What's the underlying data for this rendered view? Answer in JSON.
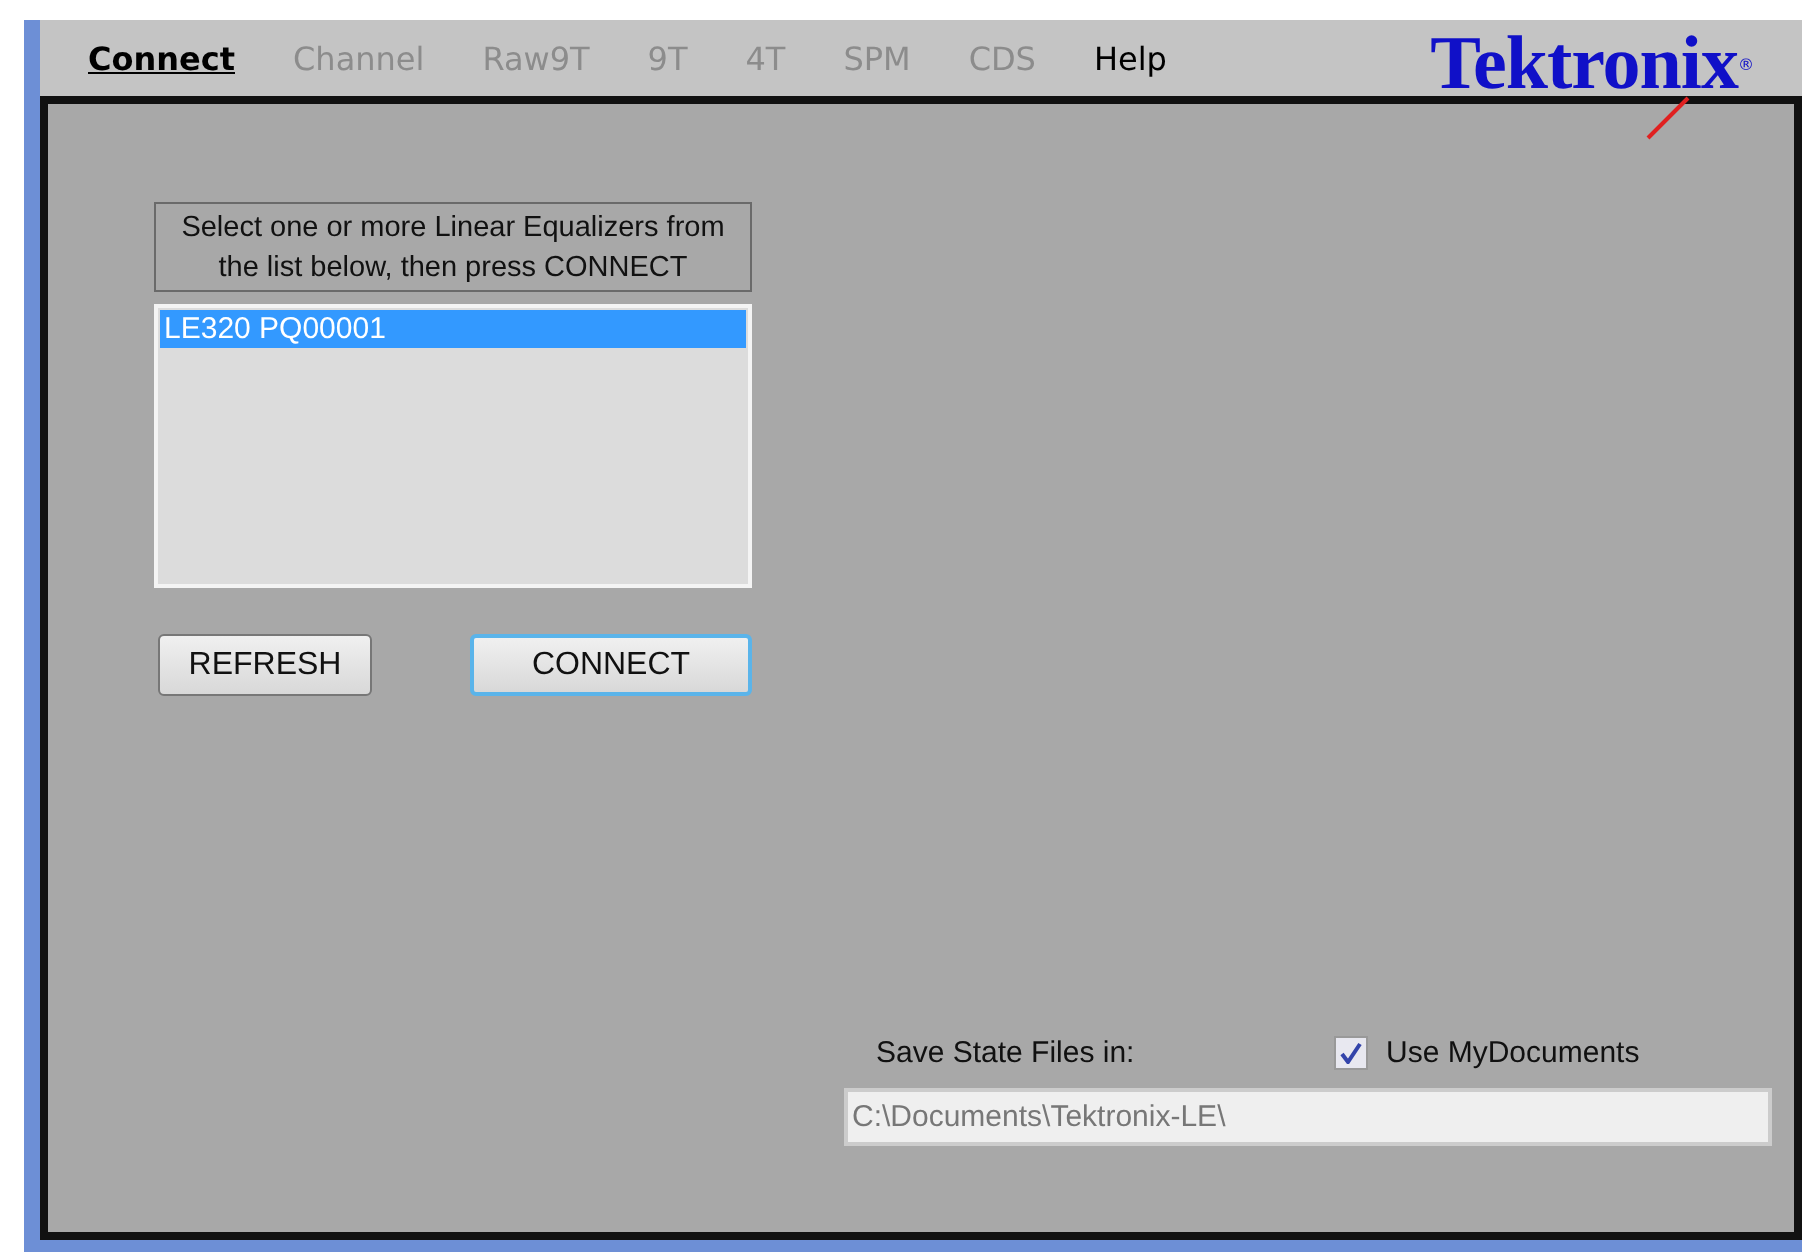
{
  "menu": [
    {
      "label": "Connect",
      "selected": true,
      "disabled": false
    },
    {
      "label": "Channel",
      "selected": false,
      "disabled": true
    },
    {
      "label": "Raw9T",
      "selected": false,
      "disabled": true
    },
    {
      "label": "9T",
      "selected": false,
      "disabled": true
    },
    {
      "label": "4T",
      "selected": false,
      "disabled": true
    },
    {
      "label": "SPM",
      "selected": false,
      "disabled": true
    },
    {
      "label": "CDS",
      "selected": false,
      "disabled": true
    },
    {
      "label": "Help",
      "selected": false,
      "disabled": false
    }
  ],
  "logo": {
    "text": "Tektronix",
    "mark": "®"
  },
  "instructions": "Select one or more Linear Equalizers from the list below, then press CONNECT",
  "device_list": [
    {
      "label": "LE320 PQ00001",
      "selected": true
    }
  ],
  "buttons": [
    {
      "label": "REFRESH",
      "focused": false
    },
    {
      "label": "CONNECT",
      "focused": true
    }
  ],
  "save_state": {
    "label": "Save State Files in:",
    "checkbox": {
      "label": "Use MyDocuments",
      "checked": true
    },
    "path": "C:\\Documents\\Tektronix-LE\\"
  }
}
